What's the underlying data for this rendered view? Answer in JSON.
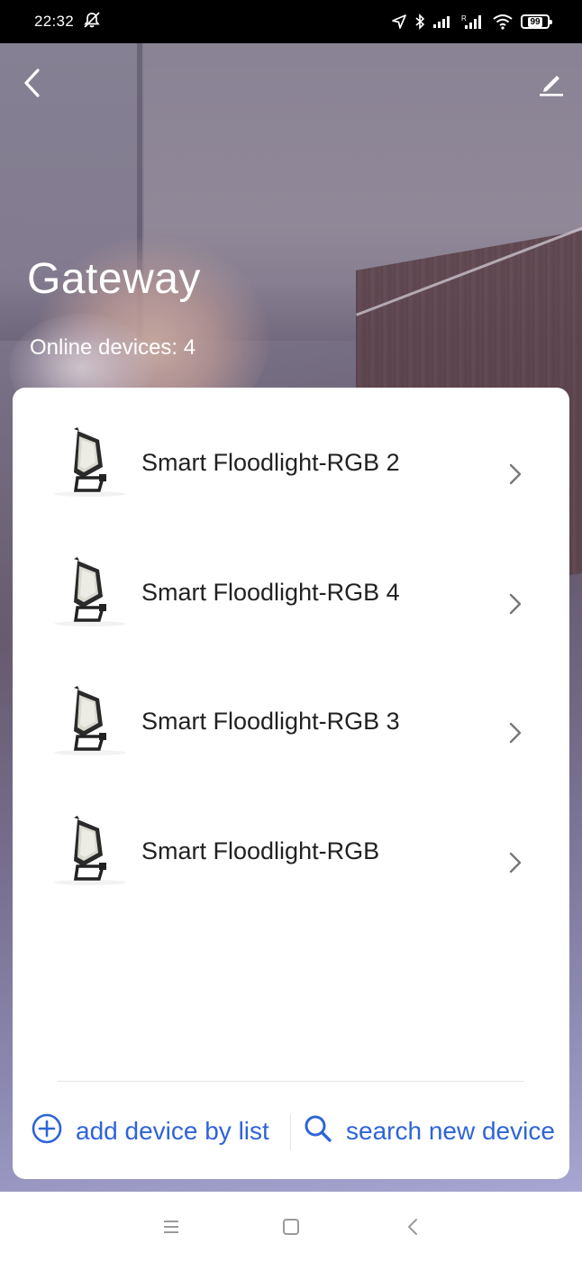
{
  "status_bar": {
    "time": "22:32",
    "battery": "99",
    "icons": [
      "alarm-off-icon",
      "location-arrow-icon",
      "bluetooth-icon",
      "signal-icon",
      "roaming-signal-icon",
      "wifi-icon",
      "battery-icon"
    ]
  },
  "header": {
    "back_icon": "chevron-left-icon",
    "edit_icon": "pencil-icon",
    "title": "Gateway",
    "online_devices": "Online devices: 4"
  },
  "devices": [
    {
      "name": "Smart Floodlight-RGB 2",
      "icon": "floodlight-thumbnail"
    },
    {
      "name": "Smart Floodlight-RGB 4",
      "icon": "floodlight-thumbnail"
    },
    {
      "name": "Smart Floodlight-RGB 3",
      "icon": "floodlight-thumbnail"
    },
    {
      "name": "Smart Floodlight-RGB",
      "icon": "floodlight-thumbnail"
    }
  ],
  "actions": {
    "add_label": "add device by list",
    "search_label": "search new device",
    "accent_color": "#2f64d8"
  },
  "nav": {
    "icons": [
      "menu-icon",
      "home-icon",
      "back-icon"
    ]
  }
}
